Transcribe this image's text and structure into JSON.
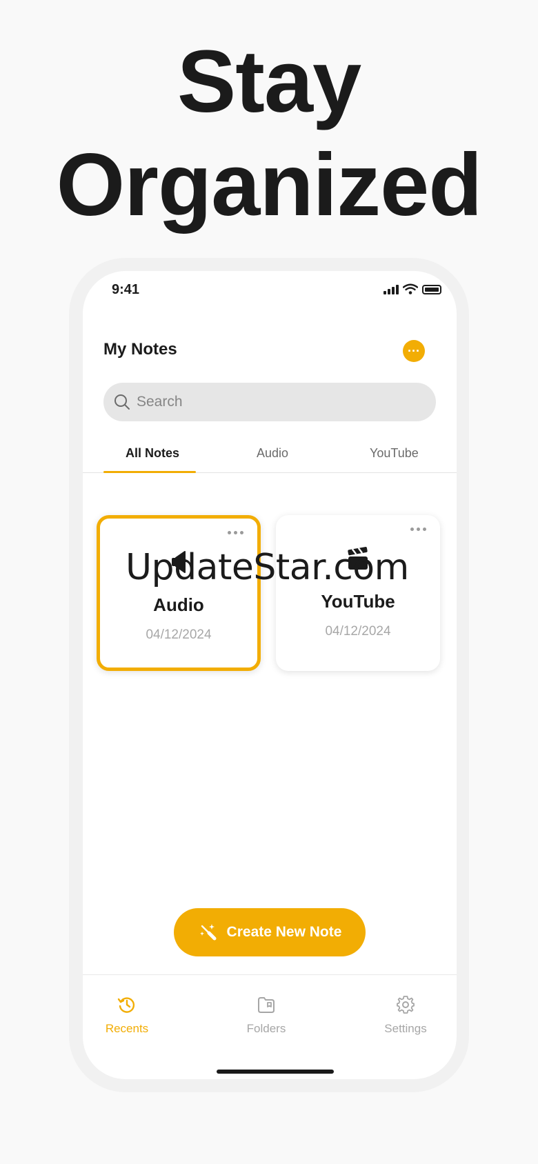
{
  "headline": {
    "line1": "Stay",
    "line2": "Organized"
  },
  "status_bar": {
    "time": "9:41"
  },
  "header": {
    "title": "My Notes",
    "more_label": "···"
  },
  "search": {
    "placeholder": "Search"
  },
  "tabs": [
    {
      "label": "All Notes",
      "active": true
    },
    {
      "label": "Audio",
      "active": false
    },
    {
      "label": "YouTube",
      "active": false
    }
  ],
  "notes": [
    {
      "name": "Audio",
      "date": "04/12/2024",
      "icon": "speaker-icon",
      "selected": true
    },
    {
      "name": "YouTube",
      "date": "04/12/2024",
      "icon": "clapperboard-icon",
      "selected": false
    }
  ],
  "watermark": "UpdateStar.com",
  "create_button": {
    "label": "Create New Note",
    "icon": "magic-wand-icon"
  },
  "bottom_nav": [
    {
      "label": "Recents",
      "icon": "history-icon",
      "active": true
    },
    {
      "label": "Folders",
      "icon": "folder-icon",
      "active": false
    },
    {
      "label": "Settings",
      "icon": "gear-icon",
      "active": false
    }
  ],
  "colors": {
    "accent": "#f2ad04",
    "text": "#1b1b1b",
    "muted": "#a6a6a6",
    "background": "#f9f9f9"
  }
}
